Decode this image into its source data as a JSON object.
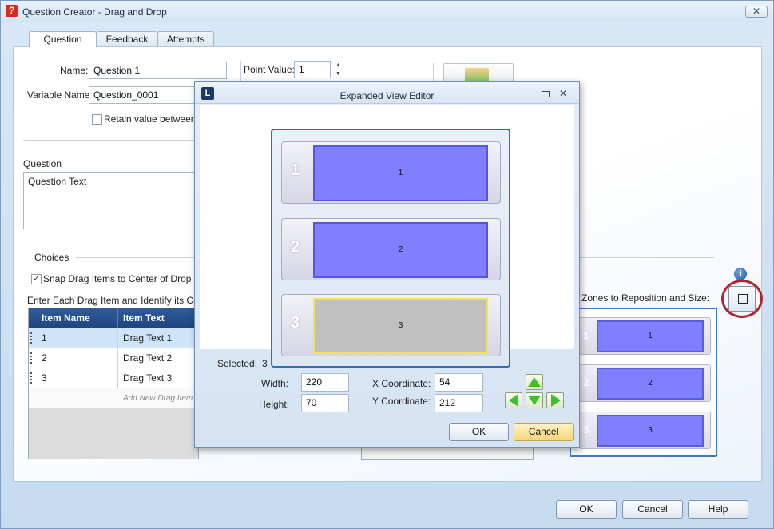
{
  "window": {
    "title": "Question Creator - Drag and Drop",
    "app_icon_glyph": "?",
    "close_glyph": "✕"
  },
  "tabs": [
    {
      "label": "Question",
      "active": true
    },
    {
      "label": "Feedback",
      "active": false
    },
    {
      "label": "Attempts",
      "active": false
    }
  ],
  "form": {
    "name_label": "Name:",
    "name_value": "Question 1",
    "variable_label": "Variable Name:",
    "variable_value": "Question_0001",
    "retain_label": "Retain value between se",
    "point_value_label": "Point Value:",
    "point_value": "1",
    "question_label": "Question",
    "question_text": "Question Text",
    "choices_label": "Choices",
    "snap_label": "Snap Drag Items to Center of Drop Zone",
    "snap_checked": "✓",
    "enter_label": "Enter Each Drag Item and Identify its Corre"
  },
  "grid": {
    "headers": [
      "Item Name",
      "Item Text"
    ],
    "rows": [
      {
        "name": "1",
        "text": "Drag Text 1"
      },
      {
        "name": "2",
        "text": "Drag Text 2"
      },
      {
        "name": "3",
        "text": "Drag Text 3"
      }
    ],
    "add_placeholder": "Add New Drag Item"
  },
  "zones_panel": {
    "label": "Zones to Reposition and Size:",
    "zones": [
      {
        "num": "1",
        "label": "1"
      },
      {
        "num": "2",
        "label": "2"
      },
      {
        "num": "3",
        "label": "3"
      }
    ],
    "info_glyph": "i"
  },
  "footer": {
    "ok": "OK",
    "cancel": "Cancel",
    "help": "Help"
  },
  "dialog": {
    "title": "Expanded View Editor",
    "icon_glyph": "L",
    "close_glyph": "✕",
    "zones": [
      {
        "num": "1",
        "label": "1",
        "selected": false
      },
      {
        "num": "2",
        "label": "2",
        "selected": false
      },
      {
        "num": "3",
        "label": "3",
        "selected": true
      }
    ],
    "selected_label": "Selected:",
    "selected_value": "3",
    "width_label": "Width:",
    "width_value": "220",
    "height_label": "Height:",
    "height_value": "70",
    "x_label": "X Coordinate:",
    "x_value": "54",
    "y_label": "Y Coordinate:",
    "y_value": "212",
    "ok": "OK",
    "cancel": "Cancel"
  },
  "colors": {
    "zone_fill": "#8080ff",
    "zone_selected_fill": "#c0c0c0",
    "grid_header": "#1f4680",
    "highlight_ring": "#b0262d",
    "arrow_green": "#3fbf2a"
  }
}
